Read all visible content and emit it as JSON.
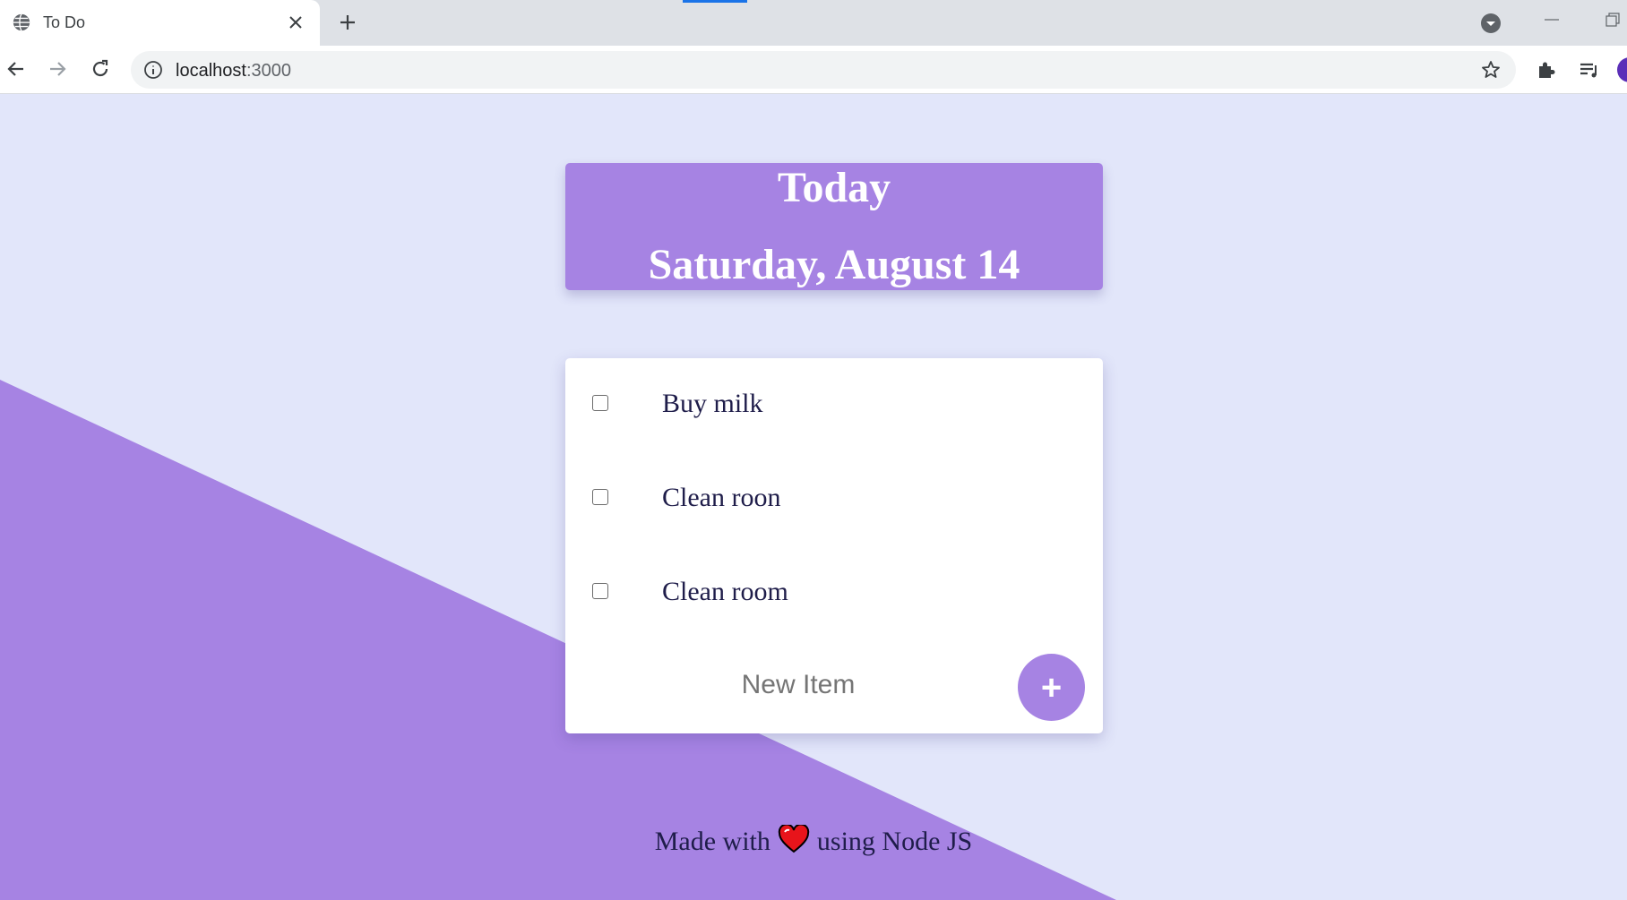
{
  "browser": {
    "tab_title": "To Do",
    "url_host": "localhost",
    "url_port": ":3000"
  },
  "header": {
    "title": "Today",
    "date": "Saturday, August 14"
  },
  "items": [
    {
      "label": "Buy milk",
      "checked": false
    },
    {
      "label": "Clean roon",
      "checked": false
    },
    {
      "label": "Clean room",
      "checked": false
    }
  ],
  "new_item": {
    "placeholder": "New Item",
    "add_label": "+"
  },
  "footer": {
    "before": "Made with",
    "after": "using Node JS"
  },
  "colors": {
    "accent": "#a683e3",
    "background": "#e2e6fa",
    "text": "#1f1d4a"
  }
}
